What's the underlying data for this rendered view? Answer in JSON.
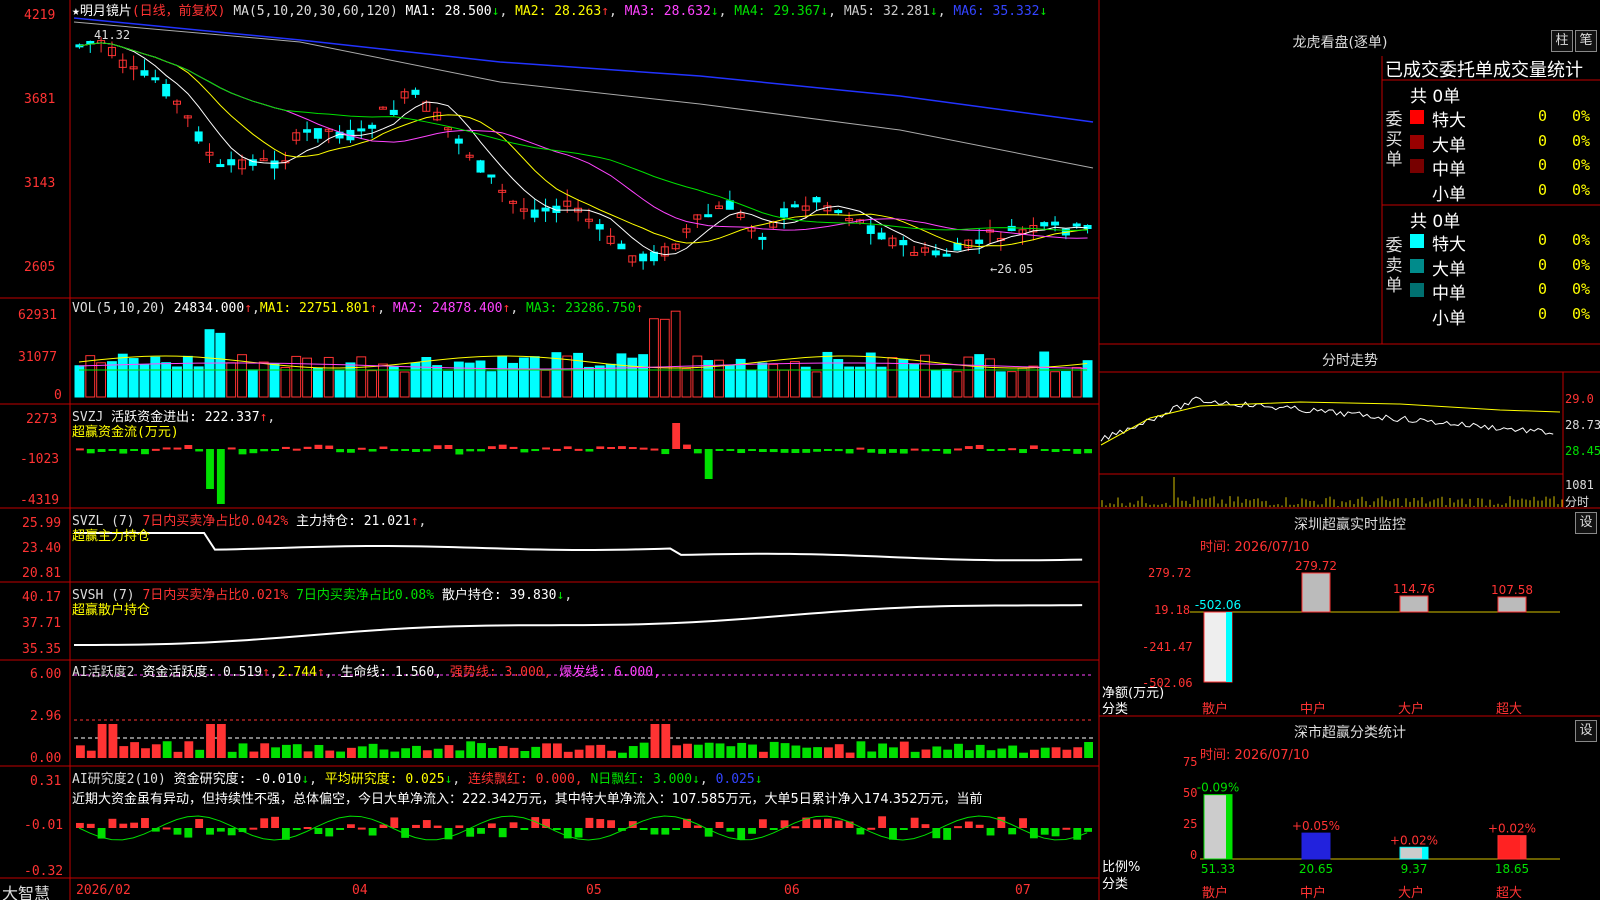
{
  "app": {
    "brand": "大智慧"
  },
  "stock": {
    "name": "★明月镜片",
    "mode": "(日线，前复权)"
  },
  "colors": {
    "up": "#ff3333",
    "down": "#00ffff",
    "green": "#00e000",
    "panel_border": "#c00000",
    "yellow": "#ffff00",
    "magenta": "#ff44ff",
    "white": "#ffffff",
    "blue": "#2233ff",
    "gray": "#aaaaaa"
  },
  "kline_header": {
    "ma_label": "MA(5,10,20,30,60,120)",
    "ma1": "MA1: 28.500",
    "ma2": "MA2: 28.263",
    "ma3": "MA3: 28.632",
    "ma4": "MA4: 29.367",
    "ma5": "MA5: 32.281",
    "ma6": "MA6: 35.332"
  },
  "kline_axis": [
    "4219",
    "3681",
    "3143",
    "2605"
  ],
  "kline_marks": {
    "high": "41.32",
    "low": "←26.05"
  },
  "vol_header": {
    "label": "VOL(5,10,20)",
    "val": "24834.000",
    "ma1": "MA1: 22751.801",
    "ma2": "MA2: 24878.400",
    "ma3": "MA3: 23286.750"
  },
  "vol_axis": [
    "62931",
    "31077",
    "0"
  ],
  "svzj_header": {
    "label": "SVZJ",
    "t1": "活跃资金进出: 222.337",
    "sub": "超赢资金流(万元)"
  },
  "svzj_axis": [
    "2273",
    "-1023",
    "-4319"
  ],
  "svzl_header": {
    "label": "SVZL (7)",
    "t1": "7日内买卖净占比0.042%",
    "t2": "主力持仓: 21.021",
    "sub": "超赢主力持仓"
  },
  "svzl_axis": [
    "25.99",
    "23.40",
    "20.81"
  ],
  "svsh_header": {
    "label": "SVSH (7)",
    "t1": "7日内买卖净占比0.021%",
    "t2": "7日内买卖净占比0.08%",
    "t3": "散户持仓: 39.830",
    "sub": "超赢散户持仓"
  },
  "svsh_axis": [
    "40.17",
    "37.71",
    "35.35"
  ],
  "ai1_header": {
    "label": "AI活跃度2",
    "t1": "资金活跃度: 0.519",
    "t2": "2.744",
    "t3": "生命线: 1.560,",
    "t4": "强势线: 3.000,",
    "t5": "爆发线: 6.000,"
  },
  "ai1_axis": [
    "6.00",
    "2.96",
    "0.00"
  ],
  "ai2_header": {
    "label": "AI研究度2(10)",
    "t1": "资金研究度: -0.010",
    "t2": "平均研究度: 0.025",
    "t3": "连续飘红: 0.000,",
    "t4": "N日飘红: 3.000",
    "t5": "0.025"
  },
  "ai2_text": "近期大资金虽有异动，但持续性不强，总体偏空，今日大单净流入：222.342万元，其中特大单净流入：107.585万元，大单5日累计净入174.352万元，当前",
  "ai2_axis": [
    "0.31",
    "-0.01",
    "-0.32"
  ],
  "time_axis": [
    "2026/02",
    "04",
    "05",
    "06",
    "07"
  ],
  "dragon": {
    "title": "龙虎看盘(逐单)",
    "btn_zhu": "柱",
    "btn_bi": "笔",
    "subtitle": "已成交委托单成交量统计",
    "buy_side": "委买单",
    "sell_side": "委卖单",
    "buy_total": "共 0单",
    "sell_total": "共 0单",
    "buy_rows": [
      {
        "label": "特大",
        "count": "0",
        "pct": "0%",
        "color": "#ff0000"
      },
      {
        "label": "大单",
        "count": "0",
        "pct": "0%",
        "color": "#990000"
      },
      {
        "label": "中单",
        "count": "0",
        "pct": "0%",
        "color": "#770000"
      },
      {
        "label": "小单",
        "count": "0",
        "pct": "0%",
        "color": "#000000"
      }
    ],
    "sell_rows": [
      {
        "label": "特大",
        "count": "0",
        "pct": "0%",
        "color": "#00ffff"
      },
      {
        "label": "大单",
        "count": "0",
        "pct": "0%",
        "color": "#008b8b"
      },
      {
        "label": "中单",
        "count": "0",
        "pct": "0%",
        "color": "#007070"
      },
      {
        "label": "小单",
        "count": "0",
        "pct": "0%",
        "color": "#000000"
      }
    ]
  },
  "intraday": {
    "title": "分时走势",
    "axis": [
      "29.0",
      "28.73",
      "28.45"
    ],
    "vol_axis": [
      "1081",
      "分时"
    ]
  },
  "sz_monitor": {
    "title": "深圳超赢实时监控",
    "set_btn": "设",
    "time": "时间: 2026/07/10",
    "axis": [
      "279.72",
      "19.18",
      "-241.47",
      "-502.06"
    ],
    "ylabel": "净额(万元)",
    "xlabel": "分类",
    "categories": [
      "散户",
      "中户",
      "大户",
      "超大"
    ],
    "values": [
      "-502.06",
      "279.72",
      "114.76",
      "107.58"
    ]
  },
  "sz_class": {
    "title": "深市超赢分类统计",
    "set_btn": "设",
    "time": "时间: 2026/07/10",
    "axis": [
      "75",
      "50",
      "25",
      "0"
    ],
    "ylabel": "比例%",
    "xlabel": "分类",
    "categories": [
      "散户",
      "中户",
      "大户",
      "超大"
    ],
    "tops": [
      "-0.09%",
      "+0.05%",
      "+0.02%",
      "+0.02%"
    ],
    "values": [
      "51.33",
      "20.65",
      "9.37",
      "18.65"
    ]
  },
  "chart_data": [
    {
      "type": "bar",
      "title": "深圳超赢实时监控",
      "ylabel": "净额(万元)",
      "categories": [
        "散户",
        "中户",
        "大户",
        "超大"
      ],
      "values": [
        -502.06,
        279.72,
        114.76,
        107.58
      ],
      "ylim": [
        -502.06,
        279.72
      ]
    },
    {
      "type": "bar",
      "title": "深市超赢分类统计",
      "ylabel": "比例%",
      "categories": [
        "散户",
        "中户",
        "大户",
        "超大"
      ],
      "values": [
        51.33,
        20.65,
        9.37,
        18.65
      ],
      "ylim": [
        0,
        75
      ]
    }
  ]
}
